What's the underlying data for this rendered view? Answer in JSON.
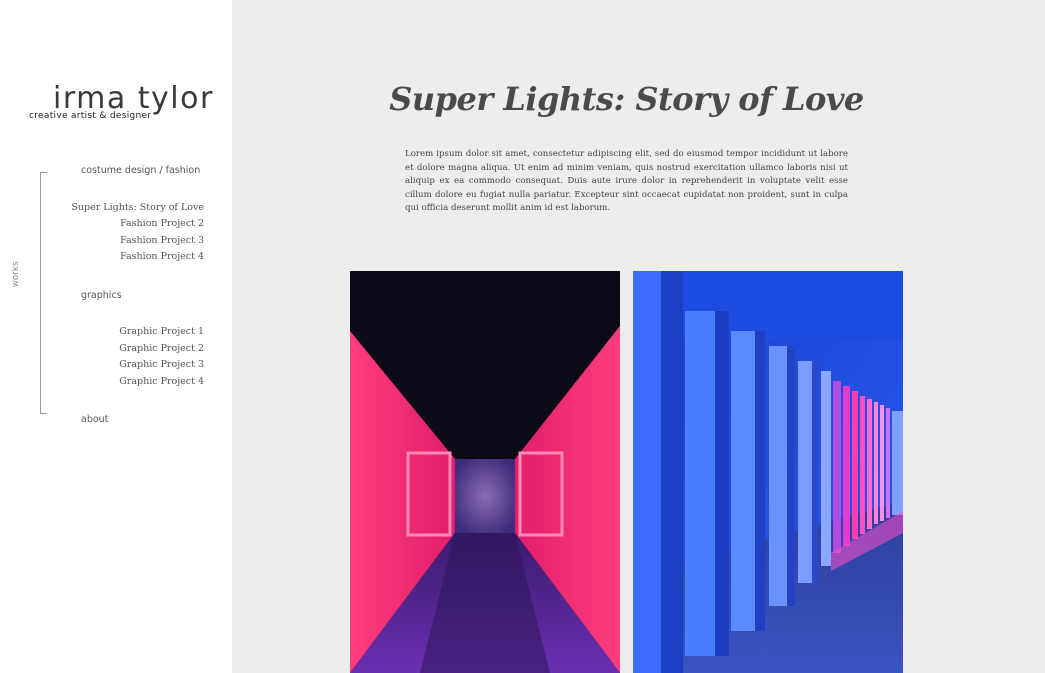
{
  "brand": {
    "name": "irma tylor",
    "tagline": "creative artist & designer"
  },
  "nav": {
    "works_label": "works",
    "costume_category": "costume design / fashion",
    "costume_items": [
      "Super Lights: Story of Love",
      "Fashion Project 2",
      "Fashion Project 3",
      "Fashion Project 4"
    ],
    "graphics_category": "graphics",
    "graphics_items": [
      "Graphic Project 1",
      "Graphic Project 2",
      "Graphic Project 3",
      "Graphic Project 4"
    ],
    "about": "about"
  },
  "main": {
    "title": "Super Lights: Story of Love",
    "intro": "Lorem ipsum dolor sit amet, consectetur adipiscing elit, sed do eiusmod tempor incididunt ut labore et dolore magna aliqua. Ut enim ad minim veniam, quis nostrud exercitation ullamco laboris nisi ut aliquip ex ea commodo consequat. Duis aute irure dolor in reprehenderit in voluptate velit esse cillum dolore eu fugiat nulla pariatur. Excepteur sint occaecat cupidatat non proident, sunt in culpa qui officia deserunt mollit anim id est laborum."
  },
  "colors": {
    "sidebar_bg": "#ffffff",
    "main_bg": "#ededed",
    "neon_pink": "#ff2d78",
    "neon_blue": "#2f6bff"
  }
}
